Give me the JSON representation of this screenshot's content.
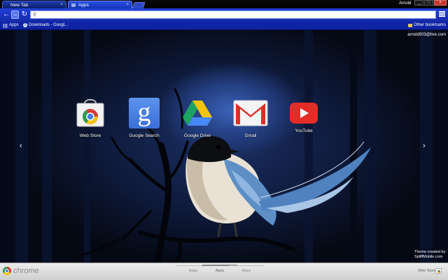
{
  "browser": {
    "tabs": [
      {
        "title": "New Tab",
        "close_glyph": "×"
      },
      {
        "title": "Apps",
        "close_glyph": "×"
      }
    ],
    "user_name": "Arnold",
    "window_controls": {
      "minimize": "_",
      "maximize": "□",
      "close": "×"
    }
  },
  "toolbar": {
    "back_glyph": "←",
    "forward_glyph": "→",
    "reload_glyph": "↻",
    "search_icon_glyph": "🔍",
    "omnibox_value": ""
  },
  "bookmarks": {
    "apps_label": "Apps",
    "items": [
      {
        "label": "Downloads - Googl..."
      }
    ],
    "other_label": "Other bookmarks"
  },
  "content": {
    "account_email": "arnold503@live.com",
    "apps": [
      {
        "label": "Web Store",
        "icon": "web-store-icon"
      },
      {
        "label": "Google Search",
        "icon": "google-search-icon",
        "glyph": "g"
      },
      {
        "label": "Google Drive",
        "icon": "google-drive-icon"
      },
      {
        "label": "Gmail",
        "icon": "gmail-icon"
      },
      {
        "label": "YouTube",
        "icon": "youtube-icon"
      }
    ],
    "prev_glyph": "‹",
    "next_glyph": "›",
    "credit_line1": "Theme created by",
    "credit_line2": "SpliffMobile.com"
  },
  "bottom_bar": {
    "brand": "chrome",
    "pages": [
      "Apps",
      "Apps",
      "Apps"
    ],
    "web_store_label": "Web Store"
  },
  "colors": {
    "tab_active": "#2a4fe0",
    "toolbar": "#1c35c4",
    "bookmarks_bar": "#0f23a5",
    "youtube_red": "#e52d27",
    "gmail_red": "#d93025"
  }
}
